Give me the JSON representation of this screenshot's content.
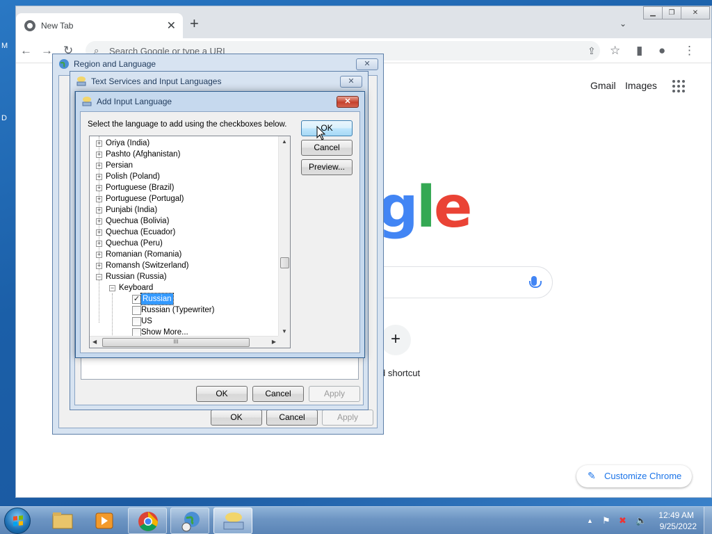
{
  "desktop": {
    "edge_letters": [
      "M",
      "D"
    ]
  },
  "chrome": {
    "tab_title": "New Tab",
    "omnibox_placeholder": "Search Google or type a URL",
    "links": {
      "gmail": "Gmail",
      "images": "Images"
    },
    "logo_visible": "gle",
    "shortcut_label": "d shortcut",
    "customize_label": "Customize Chrome"
  },
  "region_dialog": {
    "title": "Region and Language",
    "buttons": {
      "ok": "OK",
      "cancel": "Cancel",
      "apply": "Apply"
    }
  },
  "text_services_dialog": {
    "title": "Text Services and Input Languages",
    "buttons": {
      "ok": "OK",
      "cancel": "Cancel",
      "apply": "Apply"
    }
  },
  "add_language_dialog": {
    "title": "Add Input Language",
    "instruction": "Select the language to add using the checkboxes below.",
    "buttons": {
      "ok": "OK",
      "cancel": "Cancel",
      "preview": "Preview..."
    },
    "languages": [
      "Oriya (India)",
      "Pashto (Afghanistan)",
      "Persian",
      "Polish (Poland)",
      "Portuguese (Brazil)",
      "Portuguese (Portugal)",
      "Punjabi (India)",
      "Quechua (Bolivia)",
      "Quechua (Ecuador)",
      "Quechua (Peru)",
      "Romanian (Romania)",
      "Romansh (Switzerland)",
      "Russian (Russia)"
    ],
    "keyboard_label": "Keyboard",
    "keyboards": [
      {
        "label": "Russian",
        "checked": true,
        "selected": true
      },
      {
        "label": "Russian (Typewriter)",
        "checked": false,
        "selected": false
      },
      {
        "label": "US",
        "checked": false,
        "selected": false
      },
      {
        "label": "Show More...",
        "checked": false,
        "selected": false
      }
    ],
    "hscroll_grip": "III"
  },
  "taskbar": {
    "time": "12:49 AM",
    "date": "9/25/2022"
  }
}
